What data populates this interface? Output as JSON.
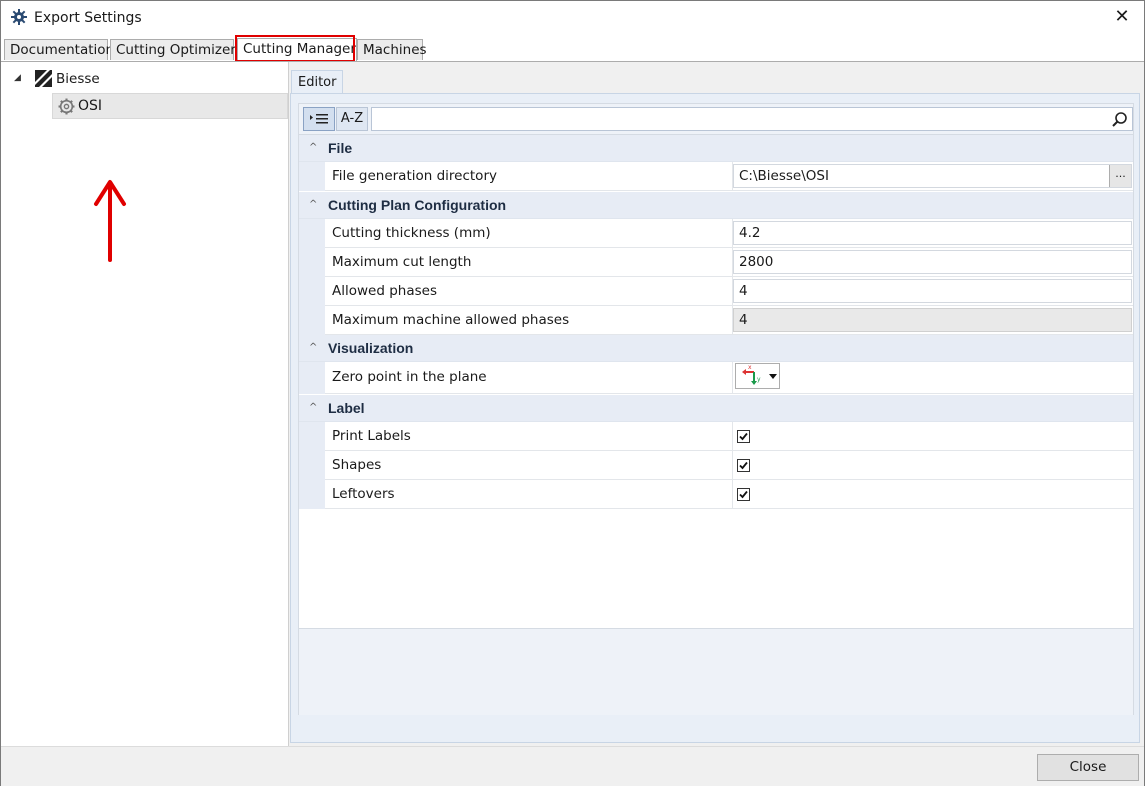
{
  "window": {
    "title": "Export Settings"
  },
  "tabs": [
    {
      "label": "Documentation"
    },
    {
      "label": "Cutting Optimizers"
    },
    {
      "label": "Cutting Manager"
    },
    {
      "label": "Machines"
    }
  ],
  "active_tab": "Cutting Manager",
  "tree": {
    "root": {
      "label": "Biesse",
      "expanded": true
    },
    "child": {
      "label": "OSI",
      "selected": true
    }
  },
  "editor": {
    "tab_label": "Editor",
    "toolbar": {
      "sort_az_label": "A-Z",
      "search_placeholder": ""
    },
    "categories": {
      "file": {
        "label": "File",
        "rows": [
          {
            "name": "File generation directory",
            "value": "C:\\Biesse\\OSI",
            "browse_label": "..."
          }
        ]
      },
      "cutting": {
        "label": "Cutting Plan Configuration",
        "rows": [
          {
            "name": "Cutting thickness (mm)",
            "value": "4.2"
          },
          {
            "name": "Maximum cut length",
            "value": "2800"
          },
          {
            "name": "Allowed phases",
            "value": "4"
          },
          {
            "name": "Maximum machine allowed phases",
            "value": "4",
            "readonly": true
          }
        ]
      },
      "visualization": {
        "label": "Visualization",
        "rows": [
          {
            "name": "Zero point in the plane",
            "icon": "axis-origin-icon"
          }
        ]
      },
      "label": {
        "label": "Label",
        "rows": [
          {
            "name": "Print Labels",
            "checked": true
          },
          {
            "name": "Shapes",
            "checked": true
          },
          {
            "name": "Leftovers",
            "checked": true
          }
        ]
      }
    }
  },
  "footer": {
    "close_label": "Close"
  },
  "colors": {
    "annotation_red": "#e00000",
    "category_bg": "#e7ecf5"
  }
}
